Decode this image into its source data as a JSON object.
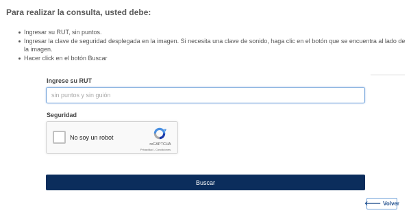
{
  "heading": "Para realizar la consulta, usted debe:",
  "instructions": [
    "Ingresar su RUT, sin puntos.",
    "Ingresar la clave de seguridad desplegada en la imagen. Si necesita una clave de sonido, haga clic en el botón que se encuentra al lado de la imagen.",
    "Hacer click en el botón Buscar"
  ],
  "form": {
    "rut_label": "Ingrese su RUT",
    "rut_placeholder": "sin puntos y sin guión",
    "rut_value": "",
    "security_label": "Seguridad"
  },
  "captcha": {
    "checkbox_label": "No soy un robot",
    "brand": "reCAPTCHA",
    "links": "Privacidad - Condiciones"
  },
  "buttons": {
    "search_label": "Buscar",
    "back_label": "Volver",
    "back_icon": "arrow-left-icon"
  },
  "colors": {
    "button_primary": "#0b2d5c",
    "input_focus_border": "#6fa1d9",
    "back_text": "#1f4e8c"
  }
}
